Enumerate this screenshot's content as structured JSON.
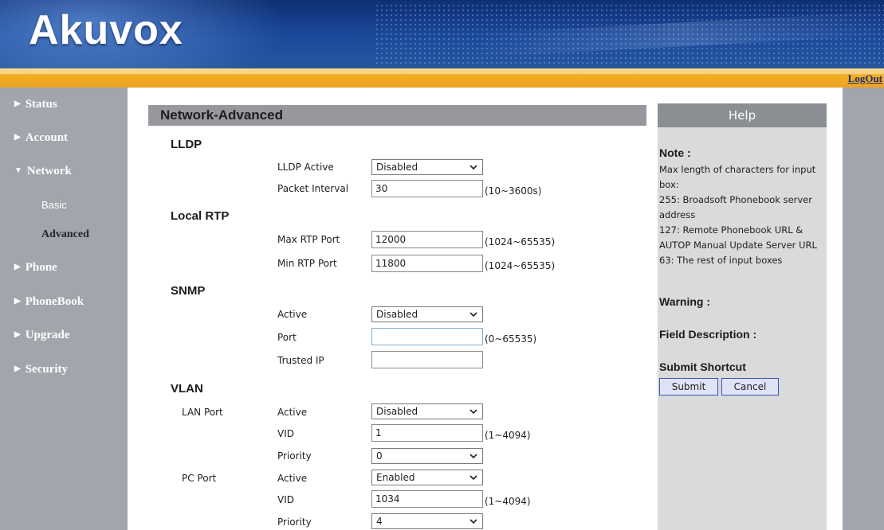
{
  "header": {
    "logo": "Akuvox",
    "logout": "LogOut"
  },
  "sidebar": {
    "items": [
      {
        "label": "Status",
        "icon": "triangle-right-icon"
      },
      {
        "label": "Account",
        "icon": "triangle-right-icon"
      },
      {
        "label": "Network",
        "icon": "triangle-down-icon"
      },
      {
        "label": "Phone",
        "icon": "triangle-right-icon"
      },
      {
        "label": "PhoneBook",
        "icon": "triangle-right-icon"
      },
      {
        "label": "Upgrade",
        "icon": "triangle-right-icon"
      },
      {
        "label": "Security",
        "icon": "triangle-right-icon"
      }
    ],
    "network_sub": {
      "basic": "Basic",
      "advanced": "Advanced"
    }
  },
  "page_title": "Network-Advanced",
  "lldp": {
    "title": "LLDP",
    "active_label": "LLDP Active",
    "active_value": "Disabled",
    "interval_label": "Packet Interval",
    "interval_value": "30",
    "interval_hint": "(10~3600s)"
  },
  "rtp": {
    "title": "Local RTP",
    "max_label": "Max RTP Port",
    "max_value": "12000",
    "max_hint": "(1024~65535)",
    "min_label": "Min RTP Port",
    "min_value": "11800",
    "min_hint": "(1024~65535)"
  },
  "snmp": {
    "title": "SNMP",
    "active_label": "Active",
    "active_value": "Disabled",
    "port_label": "Port",
    "port_value": "",
    "port_hint": "(0~65535)",
    "trusted_label": "Trusted IP",
    "trusted_value": ""
  },
  "vlan": {
    "title": "VLAN",
    "lan": {
      "label": "LAN Port",
      "active_label": "Active",
      "active_value": "Disabled",
      "vid_label": "VID",
      "vid_value": "1",
      "vid_hint": "(1~4094)",
      "priority_label": "Priority",
      "priority_value": "0"
    },
    "pc": {
      "label": "PC Port",
      "active_label": "Active",
      "active_value": "Enabled",
      "vid_label": "VID",
      "vid_value": "1034",
      "vid_hint": "(1~4094)",
      "priority_label": "Priority",
      "priority_value": "4"
    }
  },
  "help": {
    "title": "Help",
    "note_title": "Note :",
    "note_lines": [
      "Max length of characters for input",
      "box:",
      "255: Broadsoft Phonebook server",
      "address",
      "127: Remote Phonebook URL &",
      "AUTOP Manual Update Server URL",
      "63: The rest of input boxes"
    ],
    "warning_title": "Warning :",
    "field_desc_title": "Field Description :",
    "submit_shortcut_title": "Submit Shortcut",
    "submit_label": "Submit",
    "cancel_label": "Cancel"
  },
  "colors": {
    "header_blue": "#1c4a9b",
    "band_orange": "#f2ab1f",
    "sidebar_gray": "#a1a5ac",
    "help_bg": "#d8dadb"
  }
}
